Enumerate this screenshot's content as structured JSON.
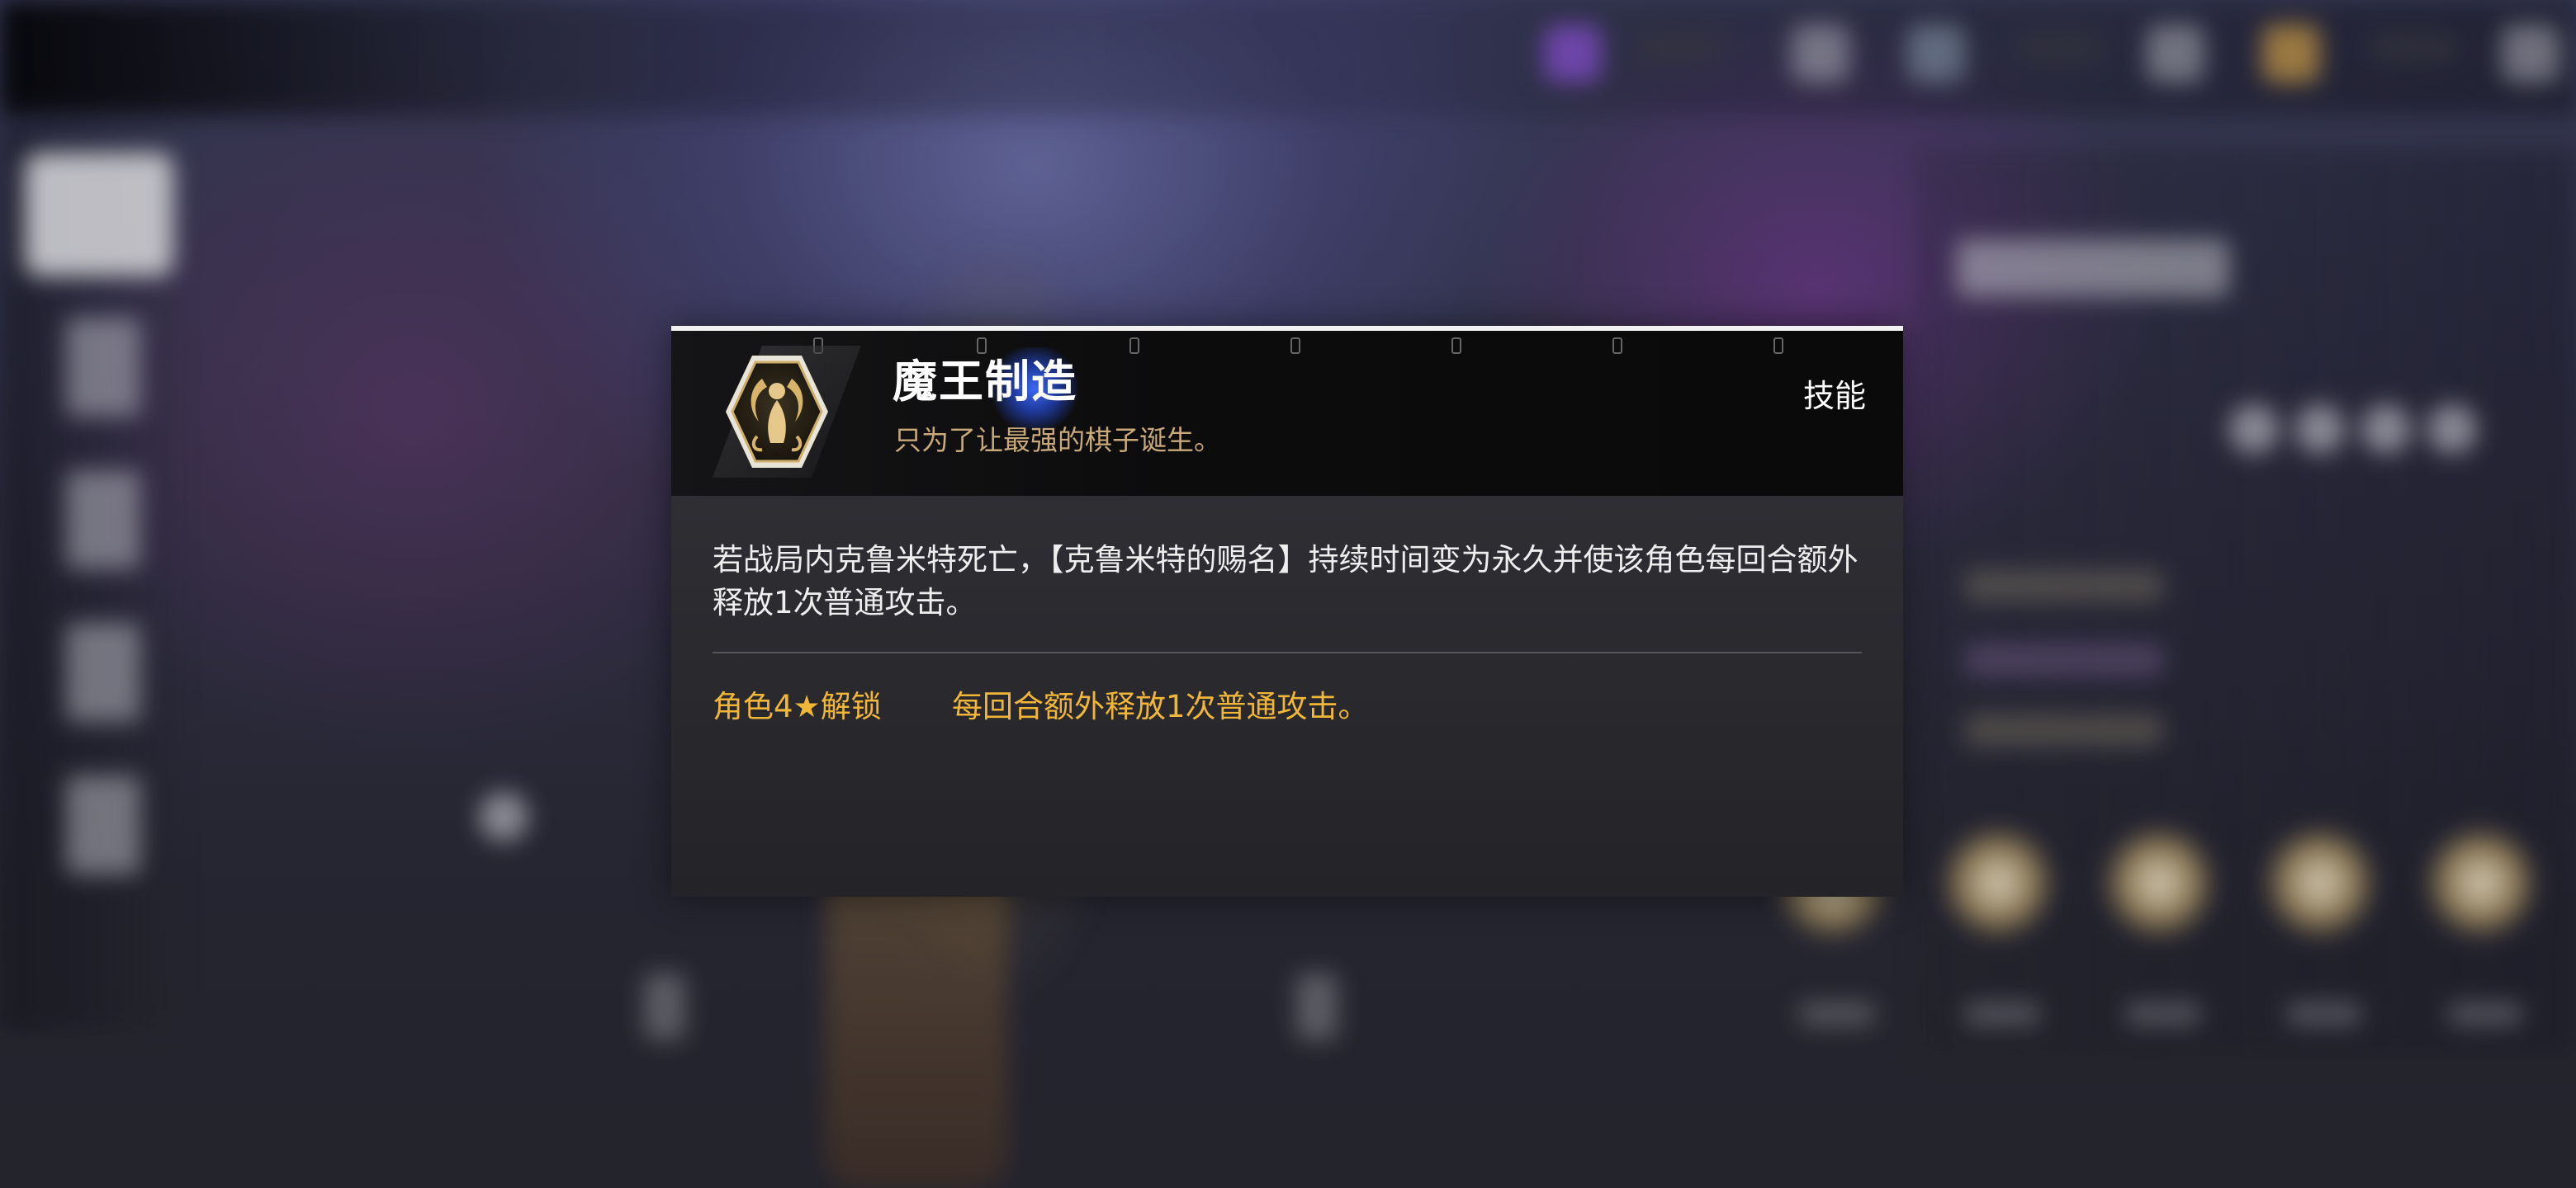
{
  "skill_popup": {
    "name": "魔王制造",
    "flavor_text": "只为了让最强的棋子诞生。",
    "type_label": "技能",
    "effect_text": "若战局内克鲁米特死亡，【克鲁米特的赐名】持续时间变为永久并使该角色每回合额外释放1次普通攻击。",
    "unlock": {
      "requirement_label": "角色4★解锁",
      "effect": "每回合额外释放1次普通攻击。"
    },
    "icon": "demon-lord-emblem-icon"
  },
  "colors": {
    "accent_gold": "#f1b638",
    "flavor_tan": "#c9a97a",
    "name_glow_blue": "#3c6eff"
  }
}
